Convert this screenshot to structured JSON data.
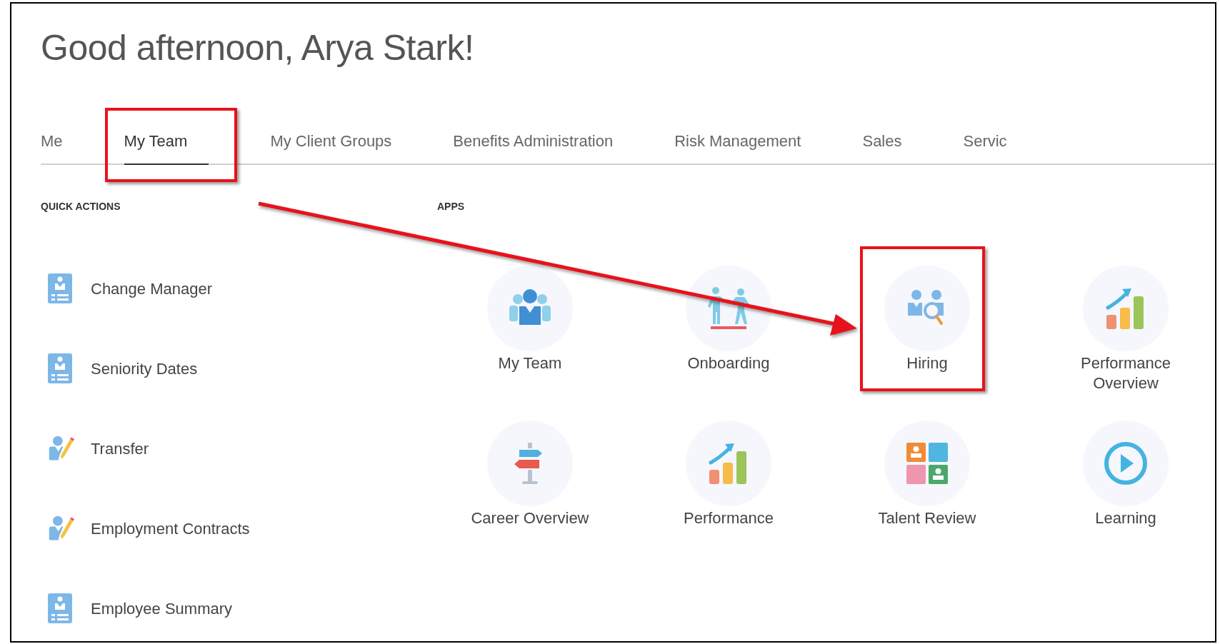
{
  "greeting": "Good afternoon, Arya Stark!",
  "tabs": [
    {
      "label": "Me",
      "selected": false,
      "annotated": false
    },
    {
      "label": "My Team",
      "selected": true,
      "annotated": true
    },
    {
      "label": "My Client Groups",
      "selected": false,
      "annotated": false
    },
    {
      "label": "Benefits Administration",
      "selected": false,
      "annotated": false
    },
    {
      "label": "Risk Management",
      "selected": false,
      "annotated": false
    },
    {
      "label": "Sales",
      "selected": false,
      "annotated": false
    },
    {
      "label": "Servic",
      "selected": false,
      "annotated": false
    }
  ],
  "quick_actions": {
    "title": "QUICK ACTIONS",
    "items": [
      {
        "label": "Change Manager",
        "kind": "card"
      },
      {
        "label": "Seniority Dates",
        "kind": "card"
      },
      {
        "label": "Transfer",
        "kind": "edit"
      },
      {
        "label": "Employment Contracts",
        "kind": "edit"
      },
      {
        "label": "Employee Summary",
        "kind": "card"
      }
    ]
  },
  "apps": {
    "title": "APPS",
    "items": [
      {
        "label": "My Team",
        "kind": "team",
        "annotated": false
      },
      {
        "label": "Onboarding",
        "kind": "onboarding",
        "annotated": false
      },
      {
        "label": "Hiring",
        "kind": "hiring",
        "annotated": true
      },
      {
        "label": "Performance Overview",
        "kind": "chart",
        "annotated": false
      },
      {
        "label": "Career Overview",
        "kind": "signpost",
        "annotated": false
      },
      {
        "label": "Performance",
        "kind": "chart",
        "annotated": false
      },
      {
        "label": "Talent Review",
        "kind": "talent",
        "annotated": false
      },
      {
        "label": "Learning",
        "kind": "play",
        "annotated": false
      }
    ]
  }
}
